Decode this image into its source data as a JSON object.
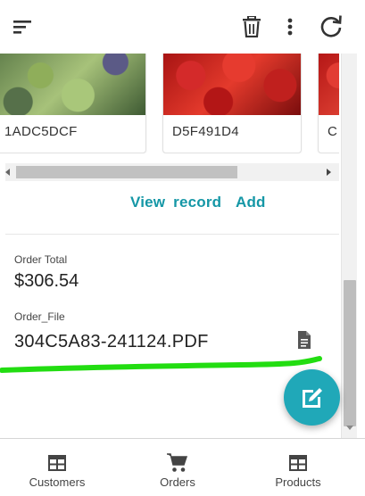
{
  "toolbar": {
    "menu_icon": "menu-icon",
    "delete_icon": "trash-icon",
    "more_icon": "more-vert-icon",
    "refresh_icon": "refresh-icon"
  },
  "gallery": {
    "cards": [
      {
        "caption": "1ADC5DCF",
        "image": "plums-photo"
      },
      {
        "caption": "D5F491D4",
        "image": "raspberries-photo"
      },
      {
        "caption": "C",
        "image": "strawberries-photo"
      }
    ]
  },
  "actions": {
    "view_record": "View record",
    "add": "Add"
  },
  "fields": {
    "order_total_label": "Order Total",
    "order_total_value": "$306.54",
    "order_file_label": "Order_File",
    "order_file_value": "304C5A83-241124.PDF",
    "file_icon": "document-icon"
  },
  "fab": {
    "icon": "edit-icon"
  },
  "bottom_nav": {
    "items": [
      {
        "label": "Customers",
        "icon": "table-icon"
      },
      {
        "label": "Orders",
        "icon": "cart-icon"
      },
      {
        "label": "Products",
        "icon": "table-icon"
      }
    ]
  },
  "colors": {
    "accent": "#1597a6",
    "fab": "#20a8b8",
    "highlight": "#22dd11"
  }
}
